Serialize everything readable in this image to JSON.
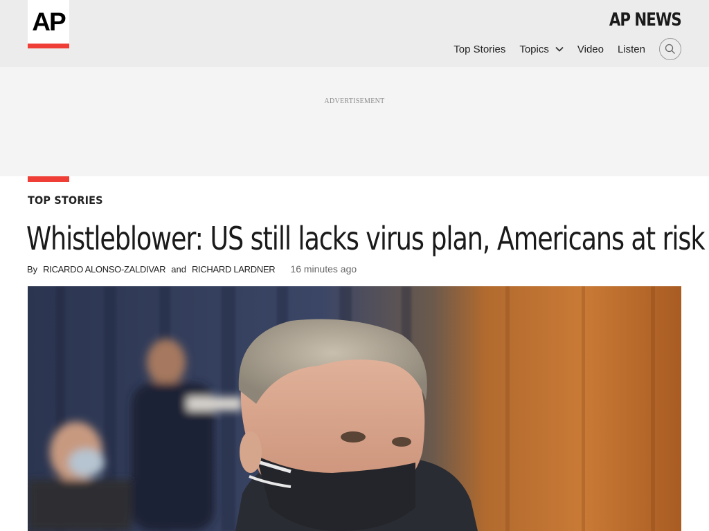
{
  "header": {
    "logo_text": "AP",
    "brand": "AP NEWS",
    "nav": [
      {
        "label": "Top Stories"
      },
      {
        "label": "Topics"
      },
      {
        "label": "Video"
      },
      {
        "label": "Listen"
      }
    ]
  },
  "ad": {
    "label": "ADVERTISEMENT"
  },
  "article": {
    "section": "TOP STORIES",
    "headline": "Whistleblower: US still lacks virus plan, Americans at risk",
    "byline_prefix": "By",
    "author1": "RICARDO ALONSO-ZALDIVAR",
    "byline_and": "and",
    "author2": "RICHARD LARDNER",
    "timestamp": "16 minutes ago"
  },
  "colors": {
    "accent": "#ef3e36",
    "header_bg": "#ececec",
    "ad_bg": "#f4f4f4"
  }
}
